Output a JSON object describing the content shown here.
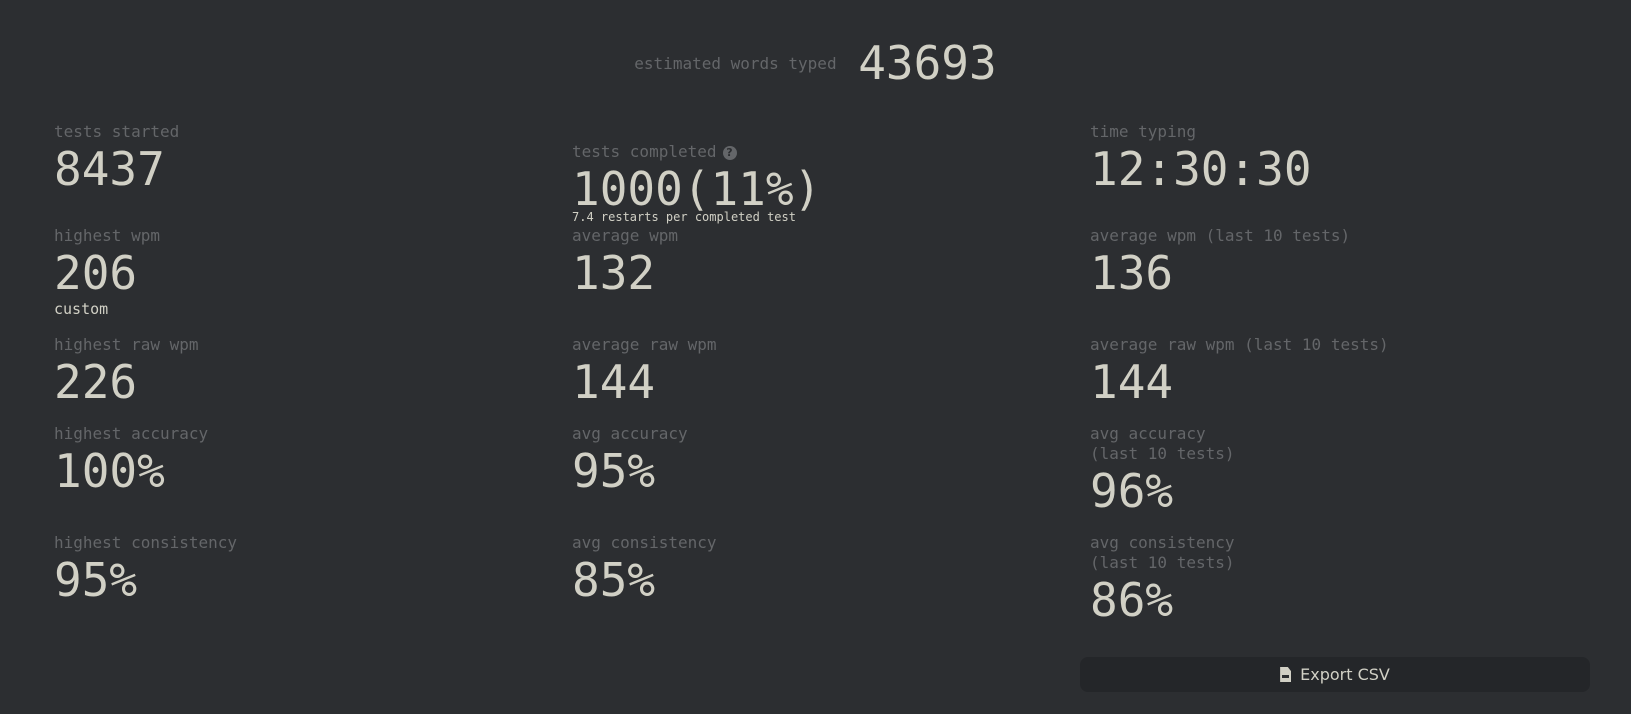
{
  "words_typed": {
    "label": "estimated words typed",
    "value": "43693"
  },
  "stats": {
    "tests_started": {
      "label": "tests started",
      "value": "8437"
    },
    "tests_completed": {
      "label": "tests completed",
      "value": "1000(11%)",
      "sub": "7.4 restarts per completed test",
      "icon": "question-circle-icon"
    },
    "time_typing": {
      "label": "time typing",
      "value": "12:30:30"
    },
    "highest_wpm": {
      "label": "highest wpm",
      "value": "206",
      "sub": "custom"
    },
    "average_wpm": {
      "label": "average wpm",
      "value": "132"
    },
    "average_wpm_last10": {
      "label": "average wpm (last 10 tests)",
      "value": "136"
    },
    "highest_raw_wpm": {
      "label": "highest raw wpm",
      "value": "226"
    },
    "average_raw_wpm": {
      "label": "average raw wpm",
      "value": "144"
    },
    "average_raw_wpm_last10": {
      "label": "average raw wpm (last 10 tests)",
      "value": "144"
    },
    "highest_accuracy": {
      "label": "highest accuracy",
      "value": "100%"
    },
    "avg_accuracy": {
      "label": "avg accuracy",
      "value": "95%"
    },
    "avg_accuracy_last10": {
      "label": "avg accuracy\n(last 10 tests)",
      "value": "96%"
    },
    "highest_consistency": {
      "label": "highest consistency",
      "value": "95%"
    },
    "avg_consistency": {
      "label": "avg consistency",
      "value": "85%"
    },
    "avg_consistency_last10": {
      "label": "avg consistency\n(last 10 tests)",
      "value": "86%"
    }
  },
  "export": {
    "label": "Export CSV",
    "icon": "csv-file-icon"
  },
  "colors": {
    "background": "#2c2e31",
    "label": "#646669",
    "text": "#d1d0c5",
    "button": "#242629"
  }
}
